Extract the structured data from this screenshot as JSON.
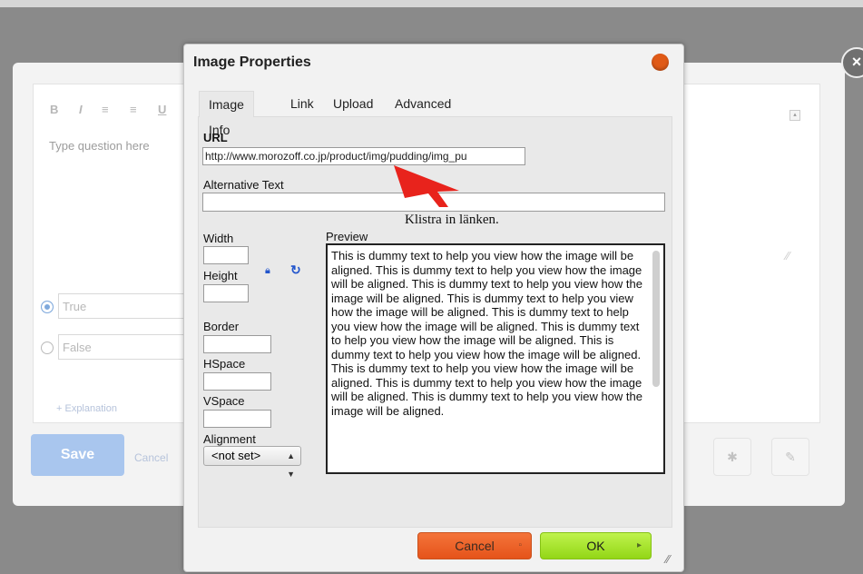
{
  "background": {
    "toolbar": {
      "bold": "B",
      "italic": "I",
      "ol": "≡",
      "ul": "≡",
      "underline": "U"
    },
    "question_placeholder": "Type question here",
    "answers": [
      {
        "label": "True",
        "checked": true
      },
      {
        "label": "False",
        "checked": false
      }
    ],
    "explanation_link": "+ Explanation",
    "save_label": "Save",
    "cancel_label": "Cancel",
    "close_glyph": "×"
  },
  "dialog": {
    "title": "Image Properties",
    "tabs": [
      {
        "label": "Image Info",
        "active": true
      },
      {
        "label": "Link",
        "active": false
      },
      {
        "label": "Upload",
        "active": false
      },
      {
        "label": "Advanced",
        "active": false
      }
    ],
    "url_label": "URL",
    "url_value": "http://www.morozoff.co.jp/product/img/pudding/img_pu",
    "alt_label": "Alternative Text",
    "alt_value": "",
    "width_label": "Width",
    "height_label": "Height",
    "border_label": "Border",
    "hspace_label": "HSpace",
    "vspace_label": "VSpace",
    "alignment_label": "Alignment",
    "alignment_value": "<not set>",
    "preview_label": "Preview",
    "preview_text": "This is dummy text to help you view how the image will be aligned. This is dummy text to help you view how the image will be aligned. This is dummy text to help you view how the image will be aligned. This is dummy text to help you view how the image will be aligned. This is dummy text to help you view how the image will be aligned. This is dummy text to help you view how the image will be aligned. This is dummy text to help you view how the image will be aligned. This is dummy text to help you view how the image will be aligned. This is dummy text to help you view how the image will be aligned. This is dummy text to help you view how the image will be aligned.",
    "cancel_label": "Cancel",
    "ok_label": "OK"
  },
  "annotation": {
    "note": "Klistra in länken.",
    "arrow_color": "#e8231c"
  }
}
